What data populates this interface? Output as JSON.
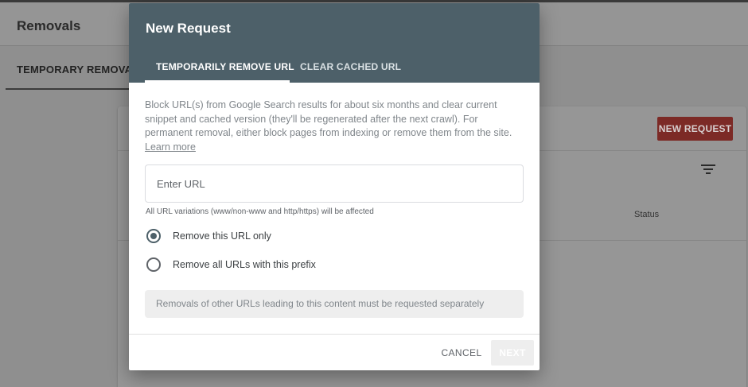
{
  "background": {
    "page_title": "Removals",
    "active_tab": "TEMPORARY REMOVALS",
    "new_request_label": "NEW REQUEST",
    "status_column": "Status",
    "filter_icon": "filter-icon"
  },
  "dialog": {
    "title": "New Request",
    "tabs": [
      {
        "label": "TEMPORARILY REMOVE URL",
        "active": true
      },
      {
        "label": "CLEAR CACHED URL",
        "active": false
      }
    ],
    "description": "Block URL(s) from Google Search results for about six months and clear current snippet and cached version (they'll be regenerated after the next crawl). For permanent removal, either block pages from indexing or remove them from the site.",
    "learn_more": "Learn more",
    "url_input": {
      "placeholder": "Enter URL",
      "value": ""
    },
    "hint": "All URL variations (www/non-www and http/https) will be affected",
    "options": [
      {
        "label": "Remove this URL only",
        "selected": true
      },
      {
        "label": "Remove all URLs with this prefix",
        "selected": false
      }
    ],
    "note": "Removals of other URLs leading to this content must be requested separately",
    "cancel_label": "CANCEL",
    "next_label": "NEXT",
    "next_enabled": false
  },
  "colors": {
    "dialog_header": "#4d6069",
    "overlay_background": "#8f8f8f",
    "new_request_button": "#7c2a26"
  }
}
